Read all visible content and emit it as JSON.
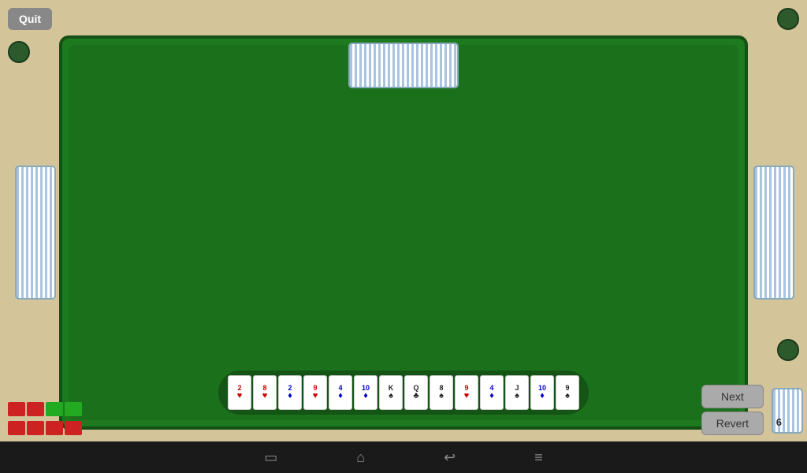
{
  "buttons": {
    "quit_label": "Quit",
    "next_label": "Next",
    "revert_label": "Revert"
  },
  "score": {
    "value": "6"
  },
  "cards": [
    {
      "rank": "2",
      "suit": "♥",
      "color": "red"
    },
    {
      "rank": "8",
      "suit": "♥",
      "color": "red"
    },
    {
      "rank": "2",
      "suit": "♦",
      "color": "blue"
    },
    {
      "rank": "9",
      "suit": "♥",
      "color": "red"
    },
    {
      "rank": "4",
      "suit": "♦",
      "color": "blue"
    },
    {
      "rank": "10",
      "suit": "♦",
      "color": "blue"
    },
    {
      "rank": "K",
      "suit": "♠",
      "color": "black"
    },
    {
      "rank": "Q",
      "suit": "♣",
      "color": "black"
    },
    {
      "rank": "8",
      "suit": "♠",
      "color": "black"
    },
    {
      "rank": "9",
      "suit": "♥",
      "color": "red"
    },
    {
      "rank": "4",
      "suit": "♦",
      "color": "blue"
    },
    {
      "rank": "J",
      "suit": "♠",
      "color": "black"
    },
    {
      "rank": "10",
      "suit": "♦",
      "color": "blue"
    },
    {
      "rank": "9",
      "suit": "♠",
      "color": "black"
    }
  ],
  "score_bars": {
    "row1": [
      "red",
      "red",
      "green",
      "green"
    ],
    "row2": [
      "red",
      "red",
      "red",
      "red"
    ]
  },
  "nav": {
    "recent_apps": "▭",
    "home": "⌂",
    "back": "↩",
    "menu": "≡"
  }
}
